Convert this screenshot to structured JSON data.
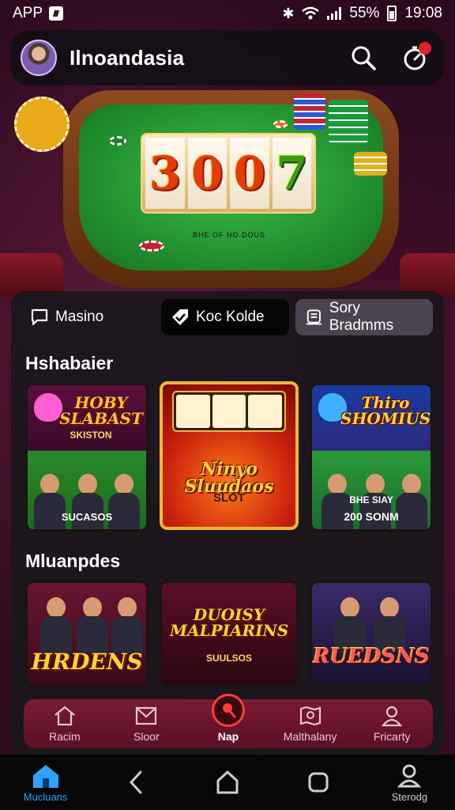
{
  "status_bar": {
    "left_label": "APP",
    "battery": "55%",
    "time": "19:08"
  },
  "header": {
    "title": "Ilnoandasia",
    "notification_badge": ""
  },
  "hero": {
    "reels": [
      "3",
      "0",
      "0",
      "7"
    ],
    "table_caption": "BHE OF HO DOUS"
  },
  "tabs": [
    {
      "label": "Masino",
      "icon": "chat-icon",
      "state": "default"
    },
    {
      "label": "Koc Kolde",
      "icon": "tag-icon",
      "state": "selected"
    },
    {
      "label": "Sory Bradmms",
      "icon": "list-icon",
      "state": "hover"
    }
  ],
  "sections": [
    {
      "title": "Hshabaier",
      "cards": [
        {
          "title": "HOBY SLABAST",
          "subtitle": "SKISTON",
          "footer": "SUCASOS"
        },
        {
          "title": "Ninyo Sluudaos",
          "subtitle": "SLOT",
          "footer": ""
        },
        {
          "title": "Thiro SHOMIUS",
          "subtitle": "BHE SIAY",
          "footer": "200 SONM"
        }
      ]
    },
    {
      "title": "Mluanpdes",
      "cards": [
        {
          "title": "HRDENS",
          "subtitle": ""
        },
        {
          "title": "DUOISY MALPIARINS",
          "subtitle": "SUULSOS"
        },
        {
          "title": "RUEDSNS",
          "subtitle": ""
        }
      ]
    }
  ],
  "app_nav": [
    {
      "label": "Racim",
      "icon": "home-outline-icon"
    },
    {
      "label": "Sloor",
      "icon": "mail-icon"
    },
    {
      "label": "Nap",
      "icon": "play-icon",
      "active": true
    },
    {
      "label": "Malthalany",
      "icon": "map-icon"
    },
    {
      "label": "Fricarty",
      "icon": "user-icon"
    }
  ],
  "system_nav": [
    {
      "label": "Mucluans",
      "icon": "home-icon",
      "active": true
    },
    {
      "label": "",
      "icon": "back-icon"
    },
    {
      "label": "",
      "icon": "home-outline-icon"
    },
    {
      "label": "",
      "icon": "recents-icon"
    },
    {
      "label": "Sterodg",
      "icon": "profile-icon"
    }
  ],
  "colors": {
    "accent_blue": "#2ea2ff",
    "nav_red": "#7a1a34",
    "play_ring": "#ff3b3b",
    "felt_green": "#1f8a2c"
  }
}
